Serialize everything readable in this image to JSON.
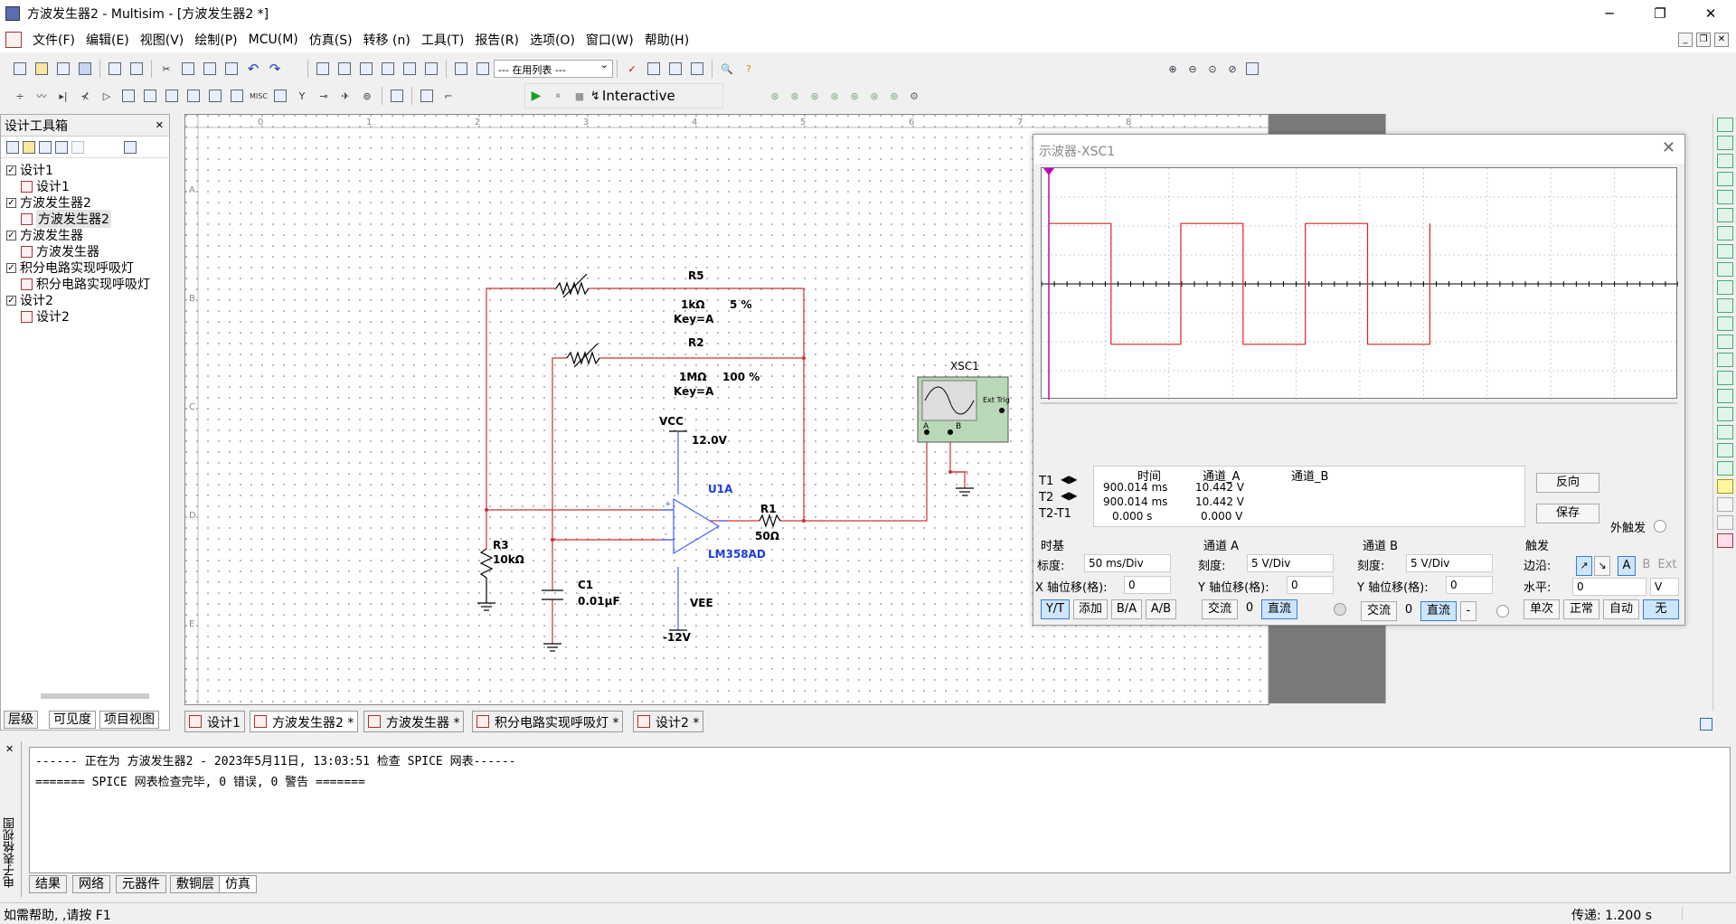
{
  "window": {
    "title": "方波发生器2 - Multisim - [方波发生器2 *]",
    "minimize": "─",
    "restore": "❐",
    "close": "✕"
  },
  "menu": [
    "文件(F)",
    "编辑(E)",
    "视图(V)",
    "绘制(P)",
    "MCU(M)",
    "仿真(S)",
    "转移 (n)",
    "工具(T)",
    "报告(R)",
    "选项(O)",
    "窗口(W)",
    "帮助(H)"
  ],
  "toolbar": {
    "in_use_list": "--- 在用列表 ---",
    "sim_mode": "Interactive",
    "sim_mode_icon": "lightning-icon"
  },
  "toolbox": {
    "title": "设计工具箱",
    "tree": [
      {
        "label": "设计1",
        "level": 0,
        "checked": true
      },
      {
        "label": "设计1",
        "level": 1
      },
      {
        "label": "方波发生器2",
        "level": 0,
        "checked": true
      },
      {
        "label": "方波发生器2",
        "level": 1,
        "selected": true
      },
      {
        "label": "方波发生器",
        "level": 0,
        "checked": true
      },
      {
        "label": "方波发生器",
        "level": 1
      },
      {
        "label": "积分电路实现呼吸灯",
        "level": 0,
        "checked": true
      },
      {
        "label": "积分电路实现呼吸灯",
        "level": 1
      },
      {
        "label": "设计2",
        "level": 0,
        "checked": true
      },
      {
        "label": "设计2",
        "level": 1
      }
    ],
    "tabs": [
      "层级",
      "可见度",
      "项目视图"
    ]
  },
  "ruler": {
    "cols": [
      "0",
      "1",
      "2",
      "3",
      "4",
      "5",
      "6",
      "7",
      "8"
    ],
    "rows": [
      "A",
      "B",
      "C",
      "D",
      "E"
    ]
  },
  "schematic": {
    "r5": {
      "name": "R5",
      "value": "1kΩ",
      "pct": "5 %",
      "key": "Key=A"
    },
    "r2": {
      "name": "R2",
      "value": "1MΩ",
      "pct": "100 %",
      "key": "Key=A"
    },
    "vcc": "VCC",
    "vcc_v": "12.0V",
    "vee": "VEE",
    "vee_v": "-12V",
    "u1": "U1A",
    "u1_part": "LM358AD",
    "r1": {
      "name": "R1",
      "value": "50Ω"
    },
    "r3": {
      "name": "R3",
      "value": "10kΩ"
    },
    "c1": {
      "name": "C1",
      "value": "0.01µF"
    },
    "xsc": "XSC1",
    "ext_trig": "Ext Trig",
    "pin_a": "A",
    "pin_b": "B"
  },
  "sheet_tabs": [
    "设计1",
    "方波发生器2 *",
    "方波发生器 *",
    "积分电路实现呼吸灯 *",
    "设计2 *"
  ],
  "scope": {
    "title": "示波器-XSC1",
    "headers": [
      "时间",
      "通道_A",
      "通道_B"
    ],
    "rows": [
      {
        "label": "T1",
        "time": "900.014 ms",
        "a": "10.442 V",
        "b": ""
      },
      {
        "label": "T2",
        "time": "900.014 ms",
        "a": "10.442 V",
        "b": ""
      },
      {
        "label": "T2-T1",
        "time": "0.000 s",
        "a": "0.000 V",
        "b": ""
      }
    ],
    "reverse": "反向",
    "save": "保存",
    "ext_trigger": "外触发",
    "timebase": {
      "title": "时基",
      "scale_label": "标度:",
      "scale": "50 ms/Div",
      "xpos_label": "X 轴位移(格):",
      "xpos": "0",
      "btns": [
        "Y/T",
        "添加",
        "B/A",
        "A/B"
      ]
    },
    "cha": {
      "title": "通道 A",
      "scale_label": "刻度:",
      "scale": "5 V/Div",
      "ypos_label": "Y 轴位移(格):",
      "ypos": "0",
      "btns": [
        "交流",
        "0",
        "直流"
      ]
    },
    "chb": {
      "title": "通道 B",
      "scale_label": "刻度:",
      "scale": "5 V/Div",
      "ypos_label": "Y 轴位移(格):",
      "ypos": "0",
      "btns": [
        "交流",
        "0",
        "直流",
        "-"
      ]
    },
    "trigger": {
      "title": "触发",
      "edge_label": "边沿:",
      "level_label": "水平:",
      "level": "0",
      "unit": "V",
      "src": [
        "A",
        "B",
        "Ext"
      ],
      "btns": [
        "单次",
        "正常",
        "自动",
        "无"
      ]
    },
    "trace_color": "#e02020",
    "cursor_color": "#c000c0",
    "waveform": {
      "div_ms": 50,
      "v_per_div": 5,
      "high_v": 10.442,
      "low_v": -10.442,
      "transitions_div": [
        1.0,
        2.12,
        3.12,
        4.12,
        5.12,
        6.12
      ]
    }
  },
  "output": {
    "lines": [
      "------ 正在为 方波发生器2 - 2023年5月11日, 13:03:51 检查 SPICE 网表------",
      "======= SPICE 网表检查完毕, 0 错误, 0 警告 ======="
    ],
    "side_label": "电子表格视图",
    "tabs": [
      "结果",
      "网络",
      "元器件",
      "敷铜层",
      "仿真"
    ]
  },
  "status": {
    "help": "如需帮助, ,请按 F1",
    "transfer": "传递: 1.200 s"
  }
}
